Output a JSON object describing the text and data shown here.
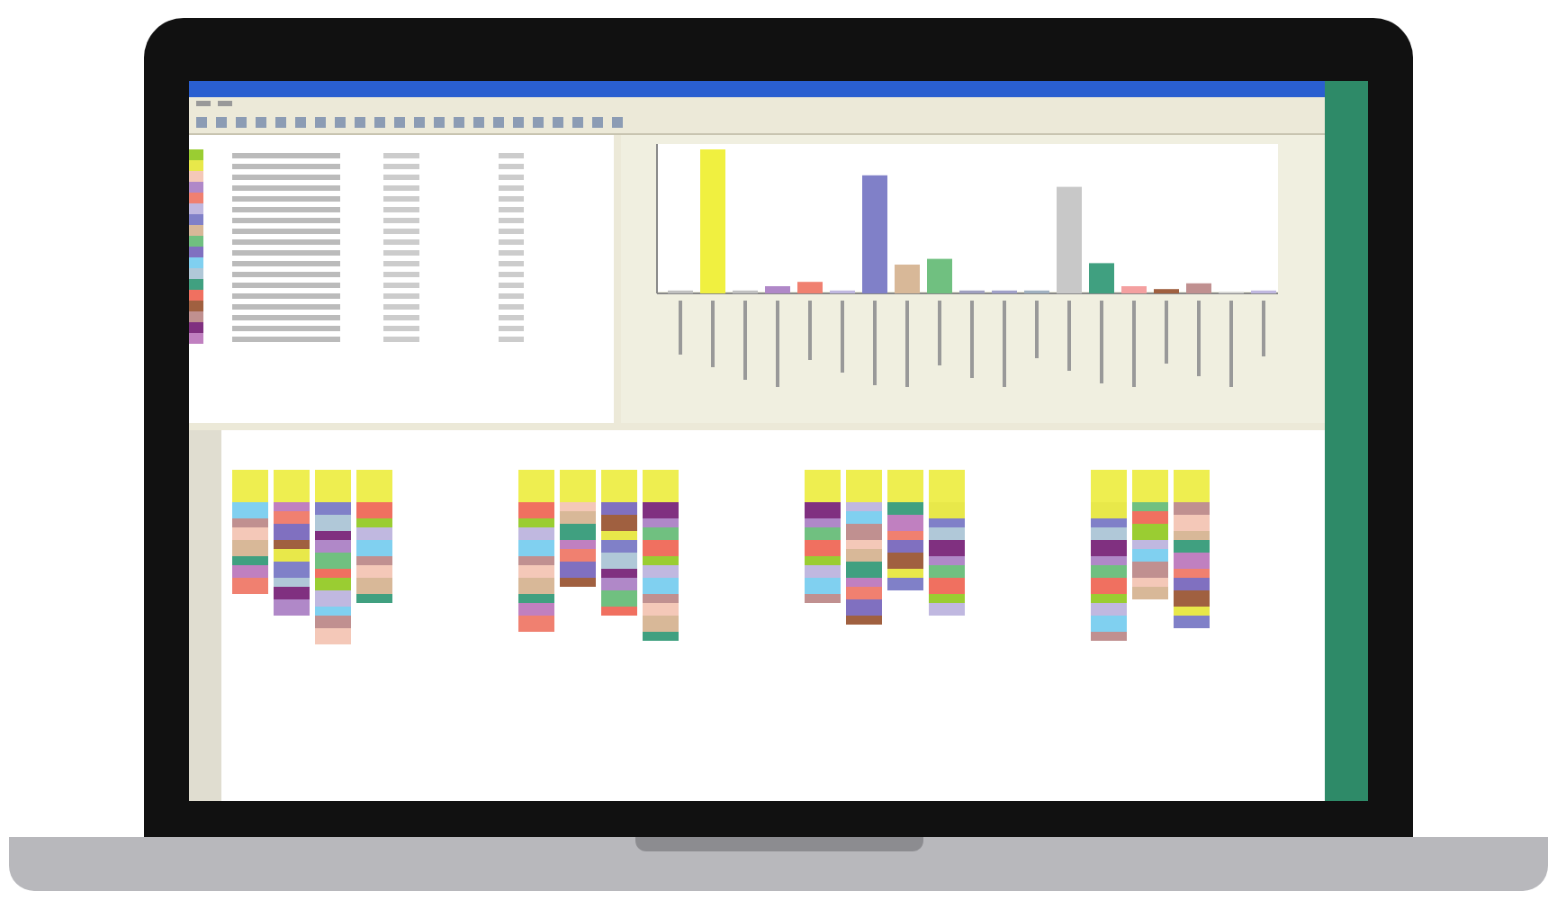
{
  "legend_rows": [
    {
      "color": "#9acd32"
    },
    {
      "color": "#e8e84a"
    },
    {
      "color": "#f4c8b8"
    },
    {
      "color": "#b088c8"
    },
    {
      "color": "#f08070"
    },
    {
      "color": "#c0b8e0"
    },
    {
      "color": "#8080c8"
    },
    {
      "color": "#d8b898"
    },
    {
      "color": "#70c080"
    },
    {
      "color": "#8070c0"
    },
    {
      "color": "#80d0f0"
    },
    {
      "color": "#b0c8d8"
    },
    {
      "color": "#40a080"
    },
    {
      "color": "#f07060"
    },
    {
      "color": "#a06040"
    },
    {
      "color": "#c09090"
    },
    {
      "color": "#803080"
    },
    {
      "color": "#c080c0"
    }
  ]
}
